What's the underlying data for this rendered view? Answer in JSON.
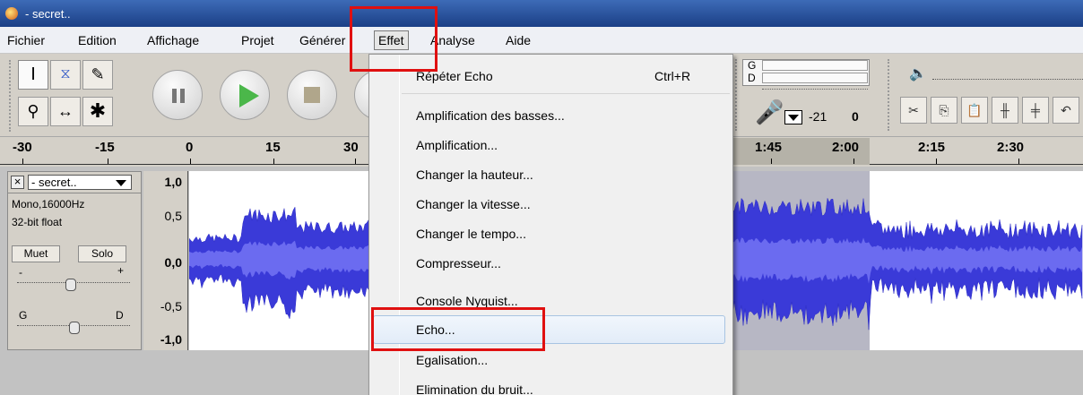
{
  "window": {
    "title": "- secret.."
  },
  "menubar": {
    "items": [
      "Fichier",
      "Edition",
      "Affichage",
      "Projet",
      "Générer",
      "Effet",
      "Analyse",
      "Aide"
    ],
    "active": "Effet"
  },
  "meters": {
    "play_label": "G",
    "rec_label": "D",
    "value1": "-21",
    "value2": "0"
  },
  "ruler": {
    "ticks": [
      "-30",
      "-15",
      "0",
      "15",
      "30",
      "1:45",
      "2:00",
      "2:15",
      "2:30"
    ]
  },
  "track": {
    "name": "- secret..",
    "format": "Mono,16000Hz",
    "bitdepth": "32-bit float",
    "mute_label": "Muet",
    "solo_label": "Solo",
    "gain_minus": "-",
    "gain_plus": "+",
    "pan_left": "G",
    "pan_right": "D",
    "scale": [
      "1,0",
      "0,5",
      "0,0",
      "-0,5",
      "-1,0"
    ]
  },
  "effect_menu": {
    "repeat": {
      "label": "Répéter Echo",
      "shortcut": "Ctrl+R"
    },
    "items": [
      "Amplification des basses...",
      "Amplification...",
      "Changer la hauteur...",
      "Changer la vitesse...",
      "Changer le tempo...",
      "Compresseur...",
      "Console Nyquist...",
      "Echo...",
      "Egalisation...",
      "Elimination du bruit..."
    ],
    "highlighted": "Echo..."
  },
  "colors": {
    "waveform": "#3a3ad8",
    "annotation": "#e01010",
    "selection": "#b7b7c4"
  }
}
